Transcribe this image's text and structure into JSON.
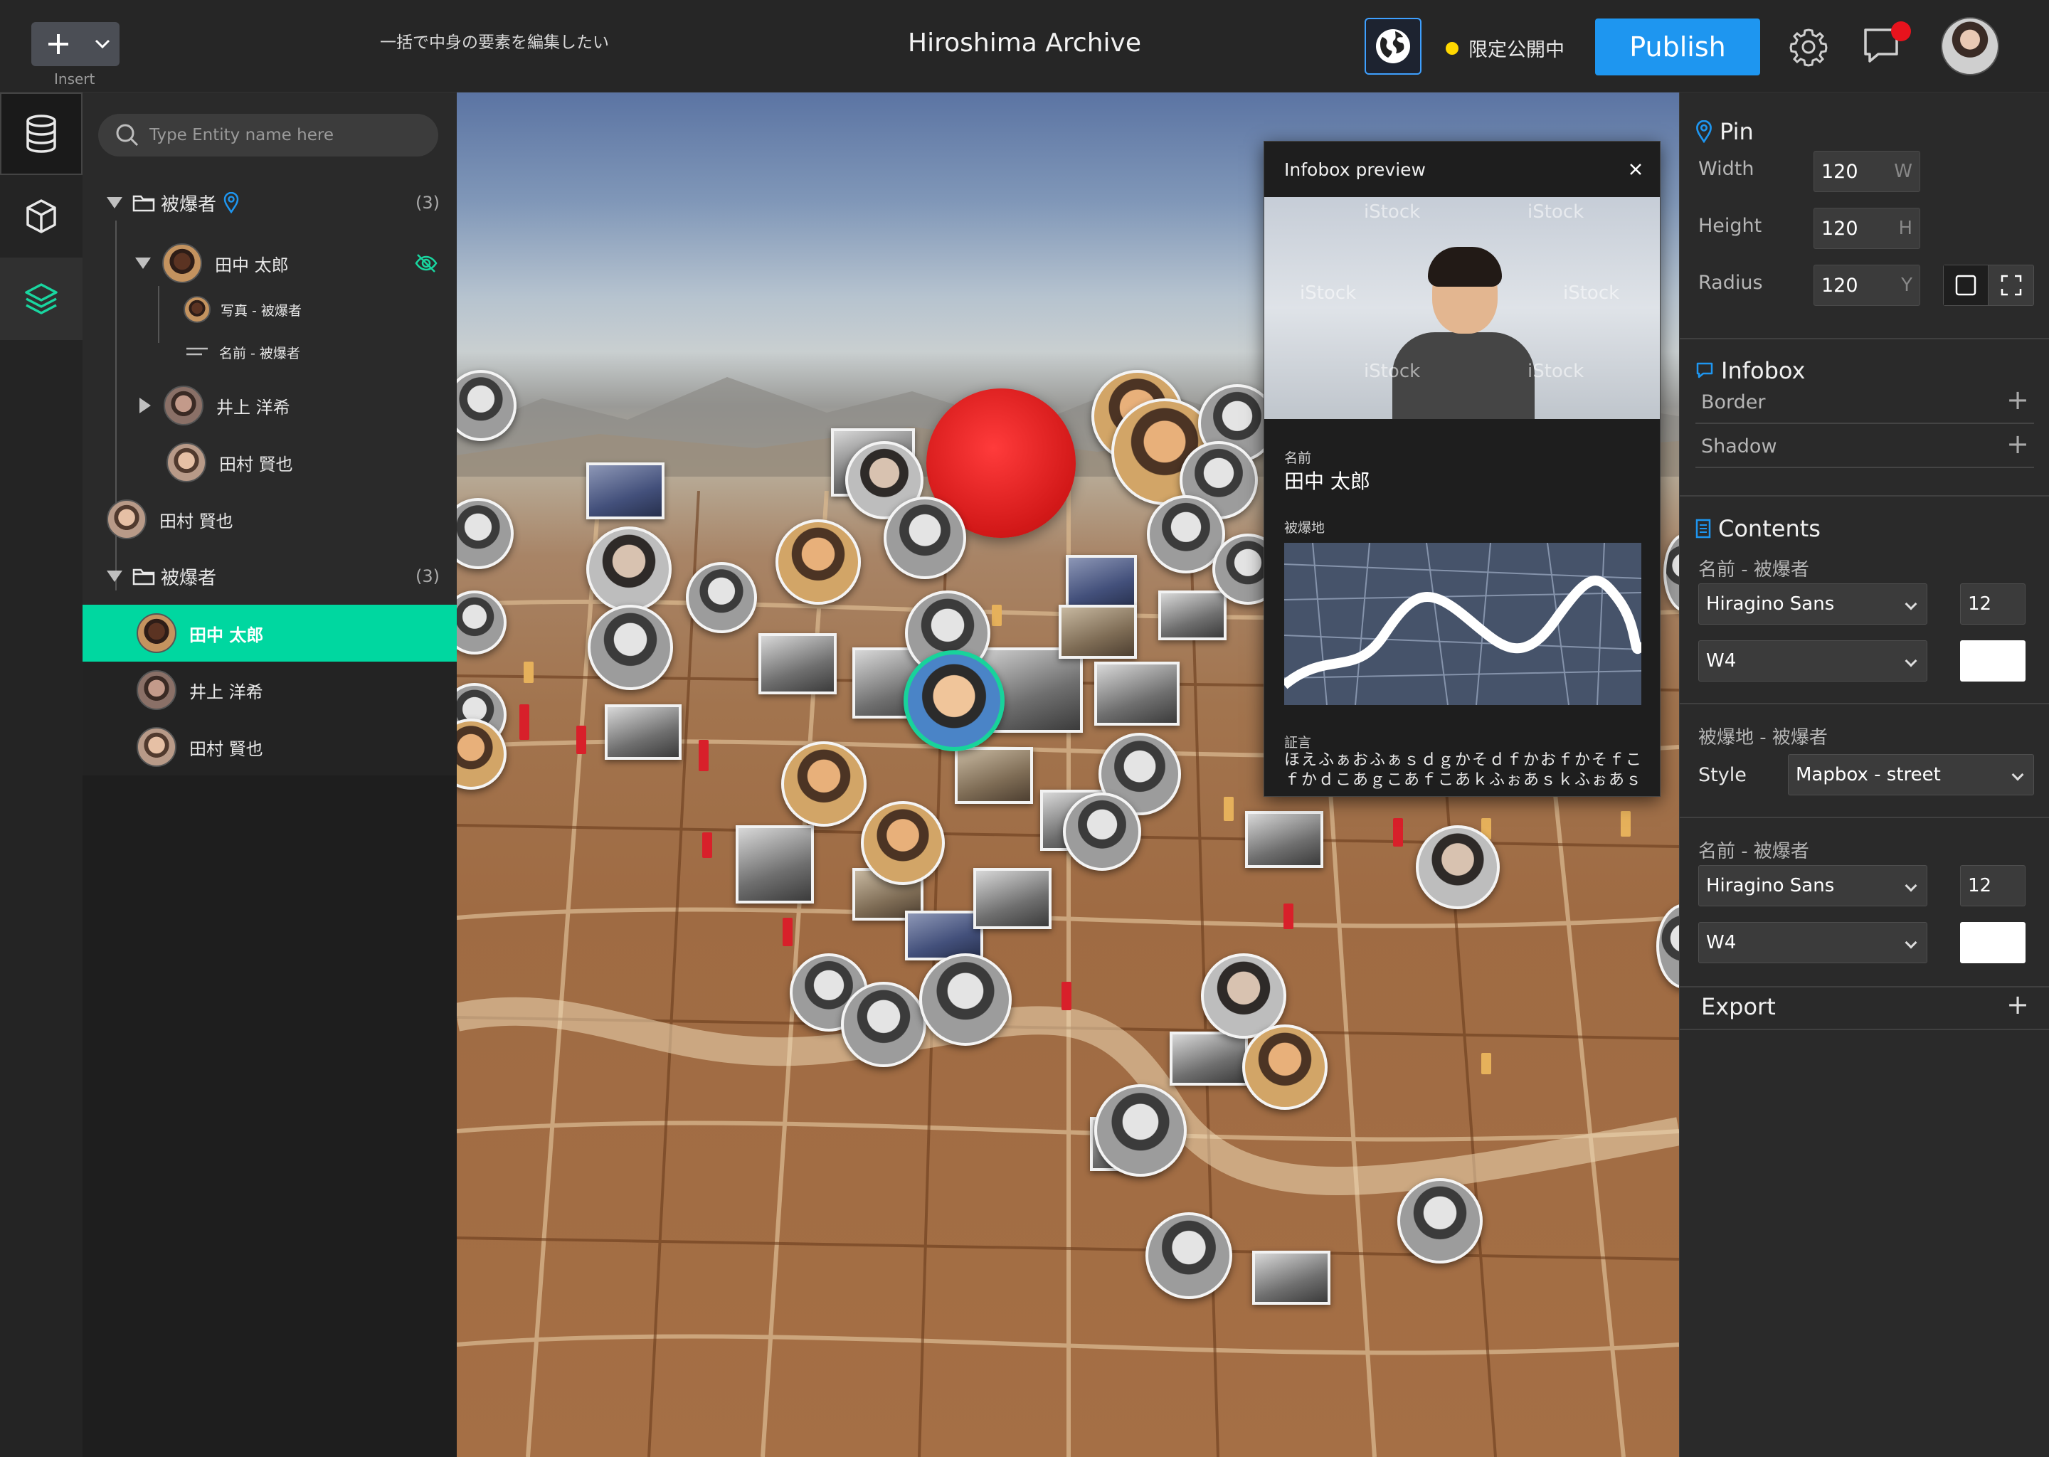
{
  "header": {
    "insert_label": "Insert",
    "note": "一括で中身の要素を編集したい",
    "title": "Hiroshima Archive",
    "status_text": "限定公開中",
    "status_color": "#ffd800",
    "publish_label": "Publish",
    "accent_color": "#1e96f0"
  },
  "rail": {
    "items": [
      "database-icon",
      "cube-icon",
      "layers-icon"
    ]
  },
  "outliner": {
    "search_placeholder": "Type Entity name here",
    "group1": {
      "label": "被爆者",
      "count": "(3)",
      "items": [
        {
          "label": "田中 太郎",
          "children": [
            "写真 - 被爆者",
            "名前 - 被爆者"
          ]
        },
        {
          "label": "井上 洋希"
        },
        {
          "label": "田村 賢也"
        }
      ]
    },
    "loose_item": "田村 賢也",
    "group2": {
      "label": "被爆者",
      "count": "(3)",
      "items": [
        "田中 太郎",
        "井上 洋希",
        "田村 賢也"
      ]
    },
    "selected_color": "#00d7a0"
  },
  "infobox": {
    "title": "Infobox preview",
    "field_name_label": "名前",
    "field_name_value": "田中 太郎",
    "field_place_label": "被爆地",
    "field_testimony_label": "証言",
    "field_testimony_value": "ほえふぁおふぁｓｄｇかそｄｆかおｆかそｆこｆかｄこあｇこあｆこあｋふぉあｓｋふぉあｓ",
    "watermark": "iStock"
  },
  "properties": {
    "pin": {
      "title": "Pin",
      "width_label": "Width",
      "width_value": "120",
      "width_suffix": "W",
      "height_label": "Height",
      "height_value": "120",
      "height_suffix": "H",
      "radius_label": "Radius",
      "radius_value": "120",
      "radius_suffix": "Y"
    },
    "infobox": {
      "title": "Infobox",
      "border_label": "Border",
      "shadow_label": "Shadow"
    },
    "contents": {
      "title": "Contents",
      "block1": {
        "label": "名前 - 被爆者",
        "font": "Hiragino Sans",
        "size": "12",
        "weight": "W4"
      },
      "block2": {
        "label": "被爆地 - 被爆者",
        "style_label": "Style",
        "style_value": "Mapbox - street"
      },
      "block3": {
        "label": "名前 - 被爆者",
        "font": "Hiragino Sans",
        "size": "12",
        "weight": "W4"
      }
    },
    "export": {
      "title": "Export"
    },
    "plus": "+"
  }
}
